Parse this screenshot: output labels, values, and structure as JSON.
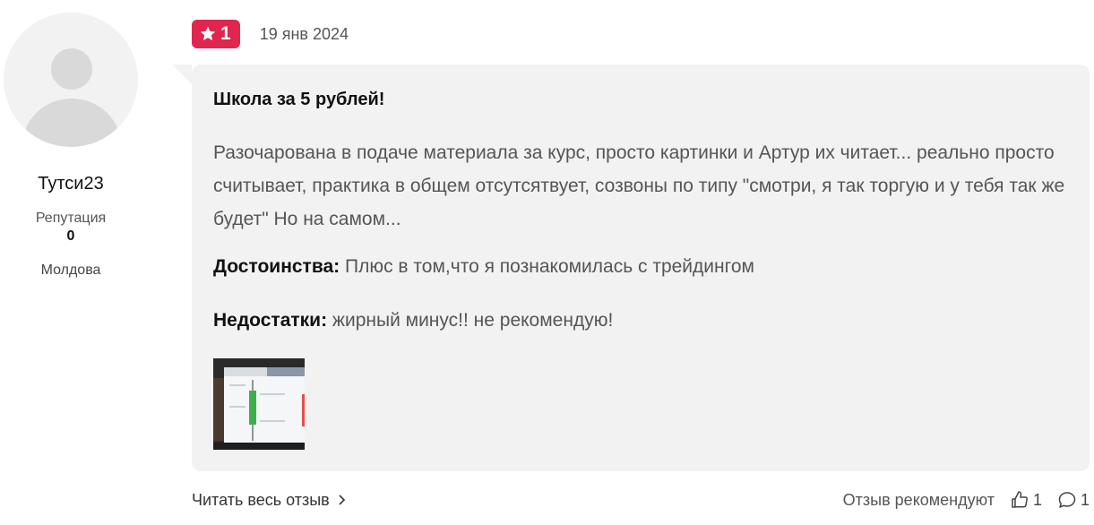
{
  "user": {
    "name": "Тутси23",
    "reputation_label": "Репутация",
    "reputation_value": "0",
    "country": "Молдова"
  },
  "review": {
    "rating": "1",
    "date": "19 янв 2024",
    "title": "Школа за 5 рублей!",
    "text": "Разочарована в подаче материала за курс, просто картинки и Артур их читает... реально просто считывает, практика в общем отсутсятвует, созвоны по типу \"смотри, я так торгую и у тебя так же будет\" Но на самом...",
    "pros_label": "Достоинства:",
    "pros": "Плюс в том,что я познакомилась с трейдингом",
    "cons_label": "Недостатки:",
    "cons": "жирный минус!! не рекомендую!"
  },
  "footer": {
    "read_more": "Читать весь отзыв",
    "recommend_label": "Отзыв рекомендуют",
    "likes": "1",
    "comments": "1"
  },
  "colors": {
    "badge": "#e0264f",
    "card": "#f2f2f2"
  },
  "icons": [
    "avatar-placeholder",
    "star-icon",
    "chevron-right-icon",
    "thumbs-up-icon",
    "comment-icon"
  ]
}
